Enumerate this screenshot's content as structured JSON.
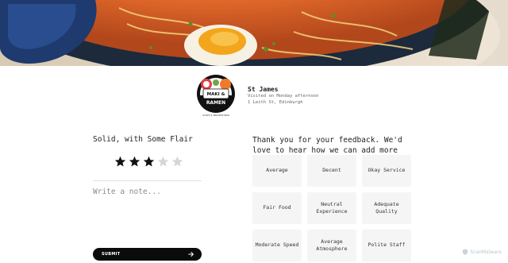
{
  "hero": {
    "image": "ramen-bowl-photo"
  },
  "restaurant": {
    "logo_text_main": "MAKI & RAMEN",
    "logo_text_sub": "SUSHI & NOODLE BAR",
    "name": "St James",
    "visit": "Visited on Monday afternoon",
    "address": "1 Leith St, Edinburgh"
  },
  "rating": {
    "title": "Solid, with Some Flair",
    "value": 3,
    "max": 5,
    "filled_color": "#111111",
    "empty_color": "#d6d6d6"
  },
  "note": {
    "placeholder": "Write a note..."
  },
  "submit": {
    "label": "SUBMIT",
    "icon": "arrow-right-icon"
  },
  "feedback": {
    "text": "Thank you for your feedback. We'd love to hear how we can add more flair.",
    "tags": [
      "Average",
      "Decent",
      "Okay Service",
      "Fair Food",
      "Neutral Experience",
      "Adequate Quality",
      "Moderate Speed",
      "Average Atmosphere",
      "Polite Staff"
    ]
  },
  "watermark": {
    "label": "ScanMalware",
    "icon": "shield-icon"
  }
}
